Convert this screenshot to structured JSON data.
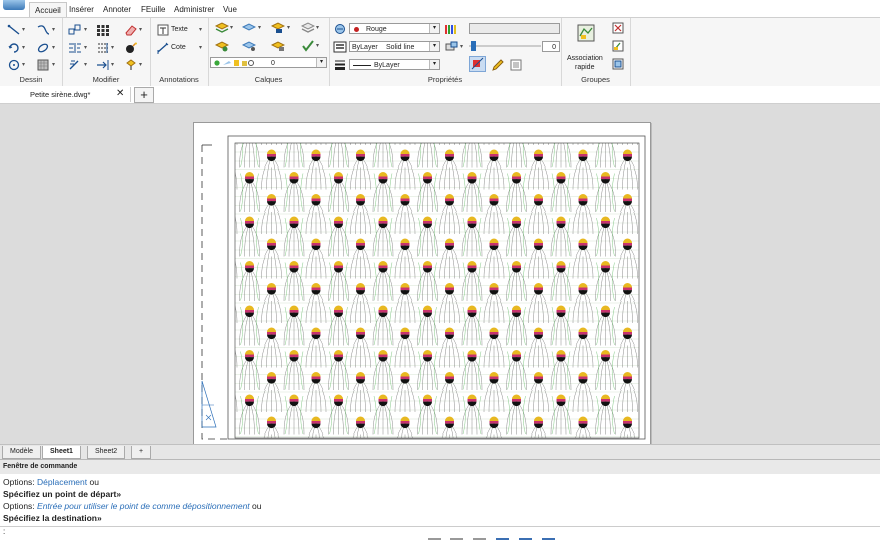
{
  "menu": {
    "tabs": [
      {
        "label": "Accueil"
      },
      {
        "label": "Insérer"
      },
      {
        "label": "Annoter"
      },
      {
        "label": "FEuille"
      },
      {
        "label": "Administrer"
      },
      {
        "label": "Vue"
      }
    ]
  },
  "ribbon": {
    "panels": {
      "dessin": "Dessin",
      "modifier": "Modifier",
      "annotations": "Annotations",
      "calques": "Calques",
      "proprietes": "Propriétés",
      "groupes": "Groupes"
    },
    "annotations": {
      "text_label": "Texte",
      "dim_label": "Cote"
    },
    "calques": {
      "layer_value": "0"
    },
    "proprietes": {
      "color_value": "Rouge",
      "linetype_layer": "ByLayer",
      "linetype_value": "Solid line",
      "lineweight_value": "ByLayer",
      "transparency_value": "0"
    },
    "groupes": {
      "assoc_label_1": "Association",
      "assoc_label_2": "rapide"
    },
    "colors": {
      "accent": "#2a6eb8",
      "red": "#c42020"
    }
  },
  "document": {
    "tab_label": "Petite sirène.dwg*",
    "close_glyph": "✕",
    "add_glyph": "+"
  },
  "layout_tabs": {
    "items": [
      "Modèle",
      "Sheet1",
      "Sheet2"
    ],
    "add_glyph": "+"
  },
  "command": {
    "title": "Fenêtre de commande",
    "l1_prefix": "Options: ",
    "l1_link": "Déplacement",
    "l1_suffix": " ou",
    "l2": "Spécifiez un point de départ»",
    "l3_prefix": "Options: ",
    "l3_link": "Entrée pour utiliser le point de comme dépositionnement",
    "l3_suffix": " ou",
    "l4": "Spécifiez la destination»",
    "prompt": ":"
  }
}
